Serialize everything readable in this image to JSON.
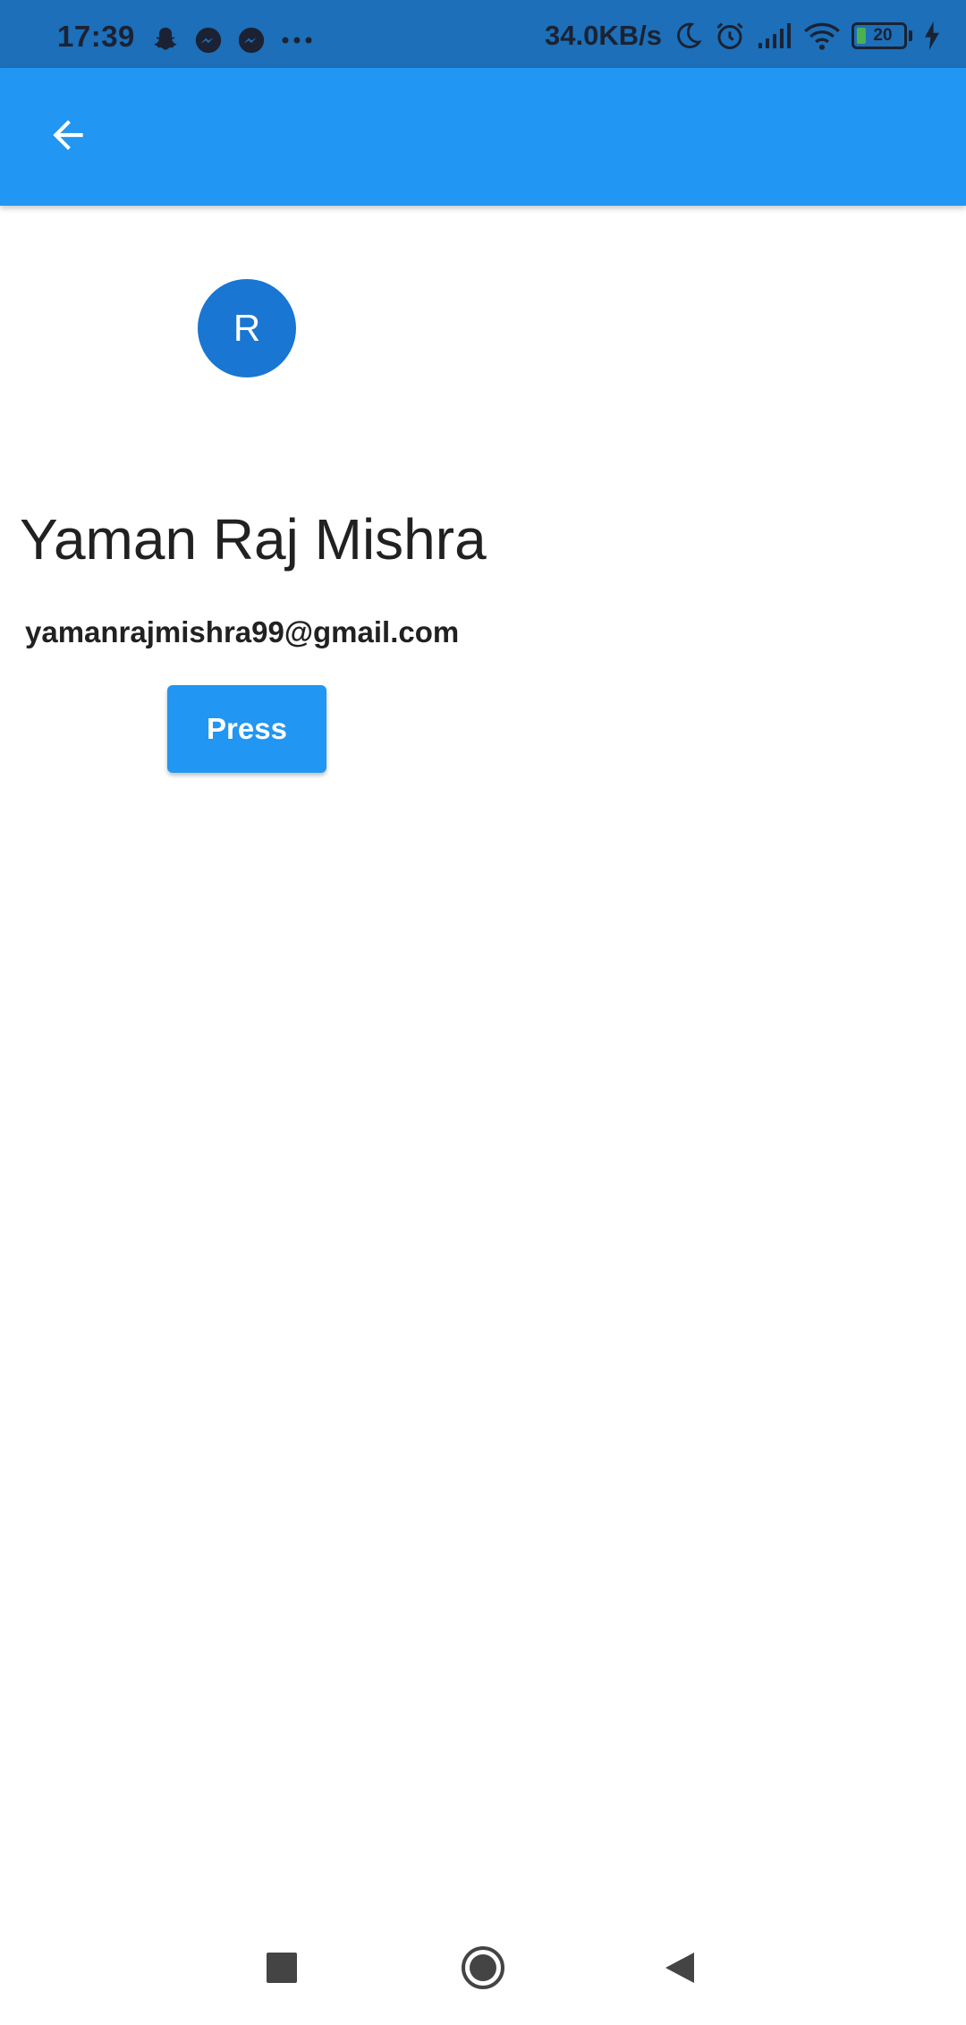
{
  "status_bar": {
    "time": "17:39",
    "network_speed": "34.0KB/s",
    "battery_level": "20",
    "icons": [
      "snapchat-icon",
      "messenger-icon",
      "messenger-icon",
      "more-dots-icon",
      "moon-icon",
      "alarm-icon",
      "signal-icon",
      "wifi-icon",
      "battery-icon",
      "charging-icon"
    ]
  },
  "app_bar": {
    "back_icon": "arrow-back-icon",
    "color": "#2196f3"
  },
  "profile": {
    "avatar_initial": "R",
    "name": "Yaman Raj Mishra",
    "email": "yamanrajmishra99@gmail.com",
    "avatar_color": "#1976d2"
  },
  "actions": {
    "press_label": "Press"
  },
  "nav_bar": {
    "icons": [
      "recents-icon",
      "home-icon",
      "back-triangle-icon"
    ]
  }
}
